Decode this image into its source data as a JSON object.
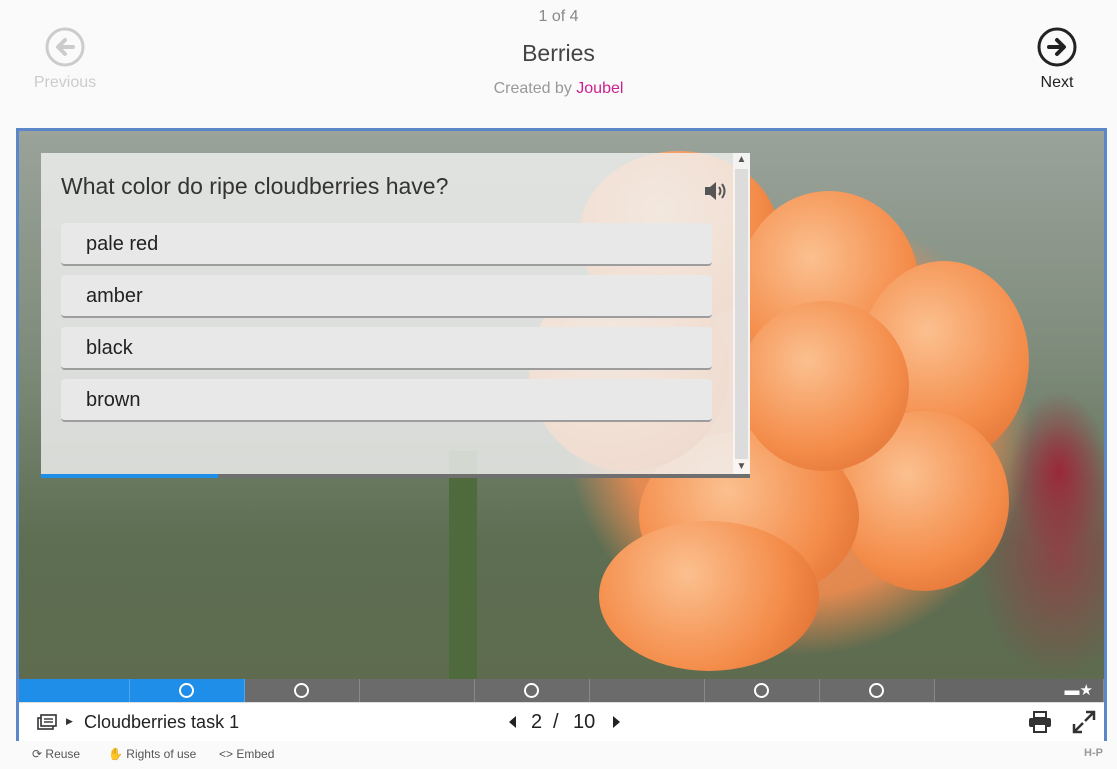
{
  "header": {
    "counter": "1 of 4",
    "title": "Berries",
    "byline_prefix": "Created by",
    "author": "Joubel",
    "prev_label": "Previous",
    "next_label": "Next"
  },
  "question": {
    "text": "What color do ripe cloudberries have?",
    "answers": [
      "pale red",
      "amber",
      "black",
      "brown"
    ],
    "progress": 0.25
  },
  "progress": {
    "segments": [
      {
        "done": true,
        "task": false
      },
      {
        "done": true,
        "task": true
      },
      {
        "done": false,
        "task": true
      },
      {
        "done": false,
        "task": false
      },
      {
        "done": false,
        "task": true
      },
      {
        "done": false,
        "task": false
      },
      {
        "done": false,
        "task": true
      },
      {
        "done": false,
        "task": true
      },
      {
        "done": false,
        "task": false,
        "summary": true
      }
    ]
  },
  "footer": {
    "slide_title": "Cloudberries task 1",
    "current": "2",
    "separator": "/",
    "total": "10"
  },
  "bottom": {
    "reuse": "Reuse",
    "rights": "Rights of use",
    "embed": "Embed",
    "brand": "H-P"
  },
  "colors": {
    "accent": "#1f8ee8",
    "frame": "#5b86c7",
    "author": "#cc2290"
  }
}
